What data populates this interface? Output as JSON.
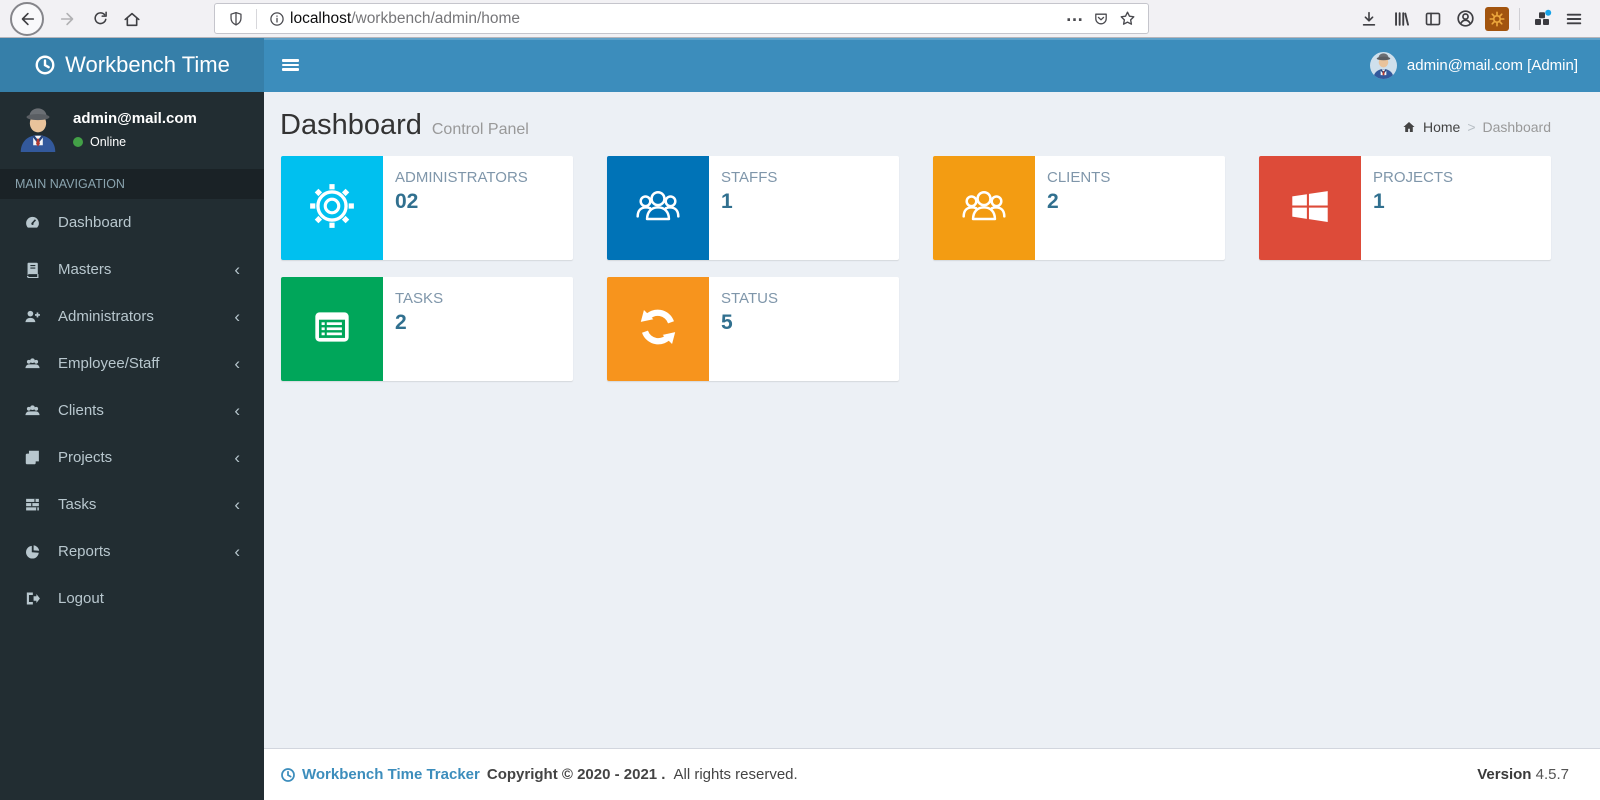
{
  "browser": {
    "url_host": "localhost",
    "url_path": "/workbench/admin/home"
  },
  "navbar": {
    "brand": "Workbench Time",
    "user_label": "admin@mail.com [Admin]"
  },
  "sidebar": {
    "user_email": "admin@mail.com",
    "user_status": "Online",
    "section_header": "MAIN NAVIGATION",
    "items": [
      {
        "label": "Dashboard",
        "icon": "dashboard-icon",
        "has_submenu": false
      },
      {
        "label": "Masters",
        "icon": "book-icon",
        "has_submenu": true
      },
      {
        "label": "Administrators",
        "icon": "user-plus-icon",
        "has_submenu": true
      },
      {
        "label": "Employee/Staff",
        "icon": "users-icon",
        "has_submenu": true
      },
      {
        "label": "Clients",
        "icon": "users-icon",
        "has_submenu": true
      },
      {
        "label": "Projects",
        "icon": "copy-icon",
        "has_submenu": true
      },
      {
        "label": "Tasks",
        "icon": "tasks-icon",
        "has_submenu": true
      },
      {
        "label": "Reports",
        "icon": "pie-chart-icon",
        "has_submenu": true
      },
      {
        "label": "Logout",
        "icon": "logout-icon",
        "has_submenu": false
      }
    ]
  },
  "content": {
    "title": "Dashboard",
    "subtitle": "Control Panel",
    "breadcrumb_home": "Home",
    "breadcrumb_sep": ">",
    "breadcrumb_current": "Dashboard",
    "info_boxes": [
      {
        "label": "ADMINISTRATORS",
        "value": "02",
        "color": "#00c0ef",
        "icon": "gear-icon"
      },
      {
        "label": "STAFFS",
        "value": "1",
        "color": "#0073b7",
        "icon": "people-icon"
      },
      {
        "label": "CLIENTS",
        "value": "2",
        "color": "#f39c12",
        "icon": "people-icon"
      },
      {
        "label": "PROJECTS",
        "value": "1",
        "color": "#dd4b39",
        "icon": "windows-icon"
      },
      {
        "label": "TASKS",
        "value": "2",
        "color": "#00a65a",
        "icon": "list-icon"
      },
      {
        "label": "STATUS",
        "value": "5",
        "color": "#f7941d",
        "icon": "refresh-icon"
      }
    ]
  },
  "footer": {
    "brand": "Workbench Time Tracker",
    "copyright": "Copyright © 2020 - 2021 .",
    "rights": "All rights reserved.",
    "version_label": "Version",
    "version_value": "4.5.7"
  },
  "theme": {
    "navbar_bg": "#3c8dbc",
    "logo_bg": "#367fa9",
    "sidebar_bg": "#222d32",
    "content_bg": "#ecf0f5",
    "number_color": "#31708f",
    "label_color": "#7f96aa",
    "online_dot": "#43a047"
  }
}
